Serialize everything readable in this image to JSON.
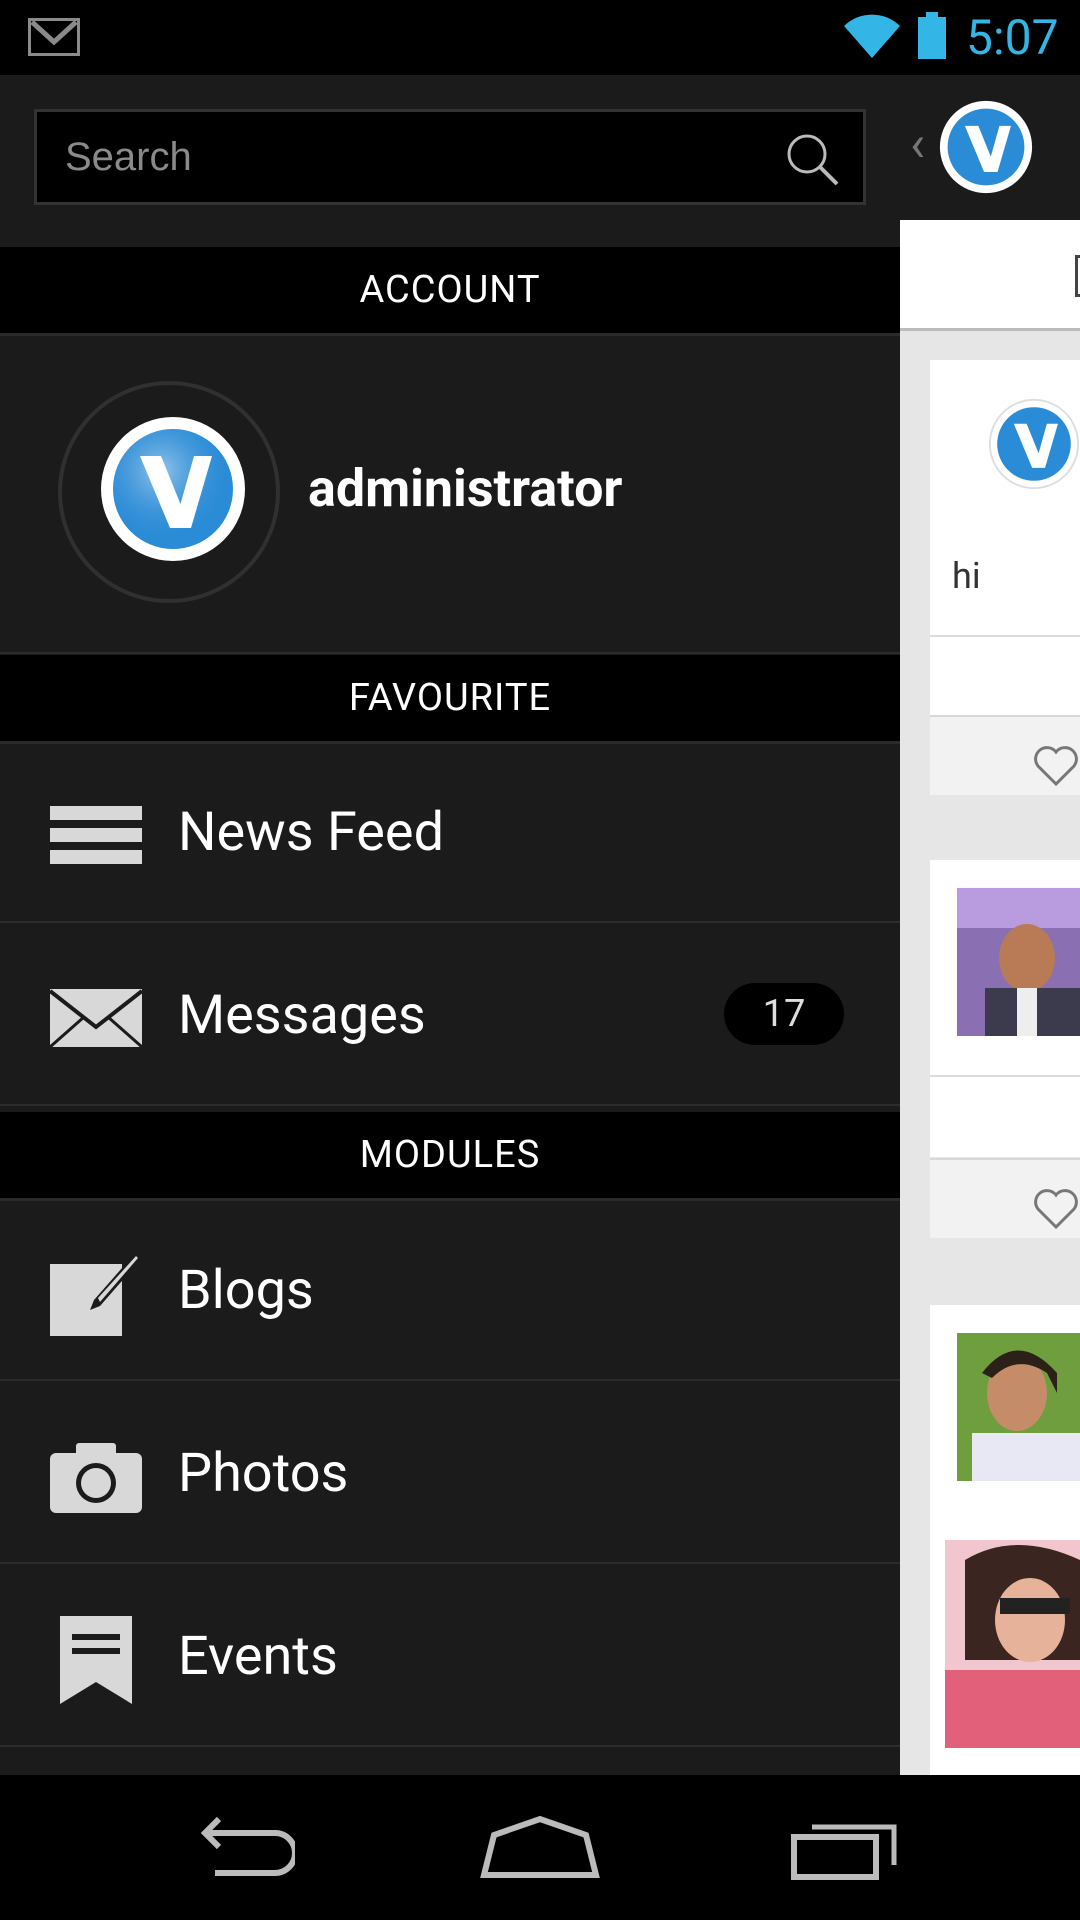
{
  "status_bar": {
    "time": "5:07",
    "icons": [
      "gmail-icon",
      "wifi-icon",
      "battery-icon"
    ],
    "accent_color": "#33b5e5"
  },
  "drawer": {
    "search": {
      "placeholder": "Search",
      "value": ""
    },
    "sections": {
      "account": "ACCOUNT",
      "favourite": "FAVOURITE",
      "modules": "MODULES"
    },
    "account": {
      "username": "administrator"
    },
    "favourite_items": [
      {
        "label": "News Feed",
        "icon": "menu-lines-icon"
      },
      {
        "label": "Messages",
        "icon": "envelope-icon",
        "badge": "17"
      }
    ],
    "module_items": [
      {
        "label": "Blogs",
        "icon": "edit-icon"
      },
      {
        "label": "Photos",
        "icon": "camera-icon"
      },
      {
        "label": "Events",
        "icon": "bookmark-icon"
      }
    ]
  },
  "content_pane": {
    "posts": [
      {
        "text": "hi",
        "icon": "heart-icon"
      },
      {
        "icon": "heart-icon"
      }
    ]
  },
  "navigation_bar": {
    "buttons": [
      "back-icon",
      "home-icon",
      "recent-apps-icon"
    ]
  }
}
